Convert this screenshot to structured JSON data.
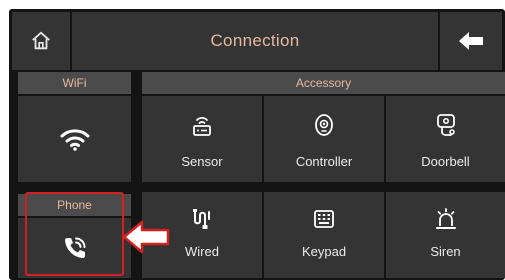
{
  "header": {
    "title": "Connection",
    "home_icon": "home-icon",
    "back_icon": "arrow-left-icon"
  },
  "left": {
    "wifi": {
      "label": "WiFi",
      "icon": "wifi-icon"
    },
    "phone": {
      "label": "Phone",
      "icon": "phone-signal-icon"
    }
  },
  "accessory": {
    "label": "Accessory",
    "items": [
      {
        "label": "Sensor",
        "icon": "sensor-icon"
      },
      {
        "label": "Controller",
        "icon": "controller-icon"
      },
      {
        "label": "Doorbell",
        "icon": "doorbell-icon"
      },
      {
        "label": "Wired",
        "icon": "wired-icon"
      },
      {
        "label": "Keypad",
        "icon": "keypad-icon"
      },
      {
        "label": "Siren",
        "icon": "siren-icon"
      }
    ]
  },
  "colors": {
    "accent_text": "#e7b99e",
    "panel": "#343434",
    "background": "#141414",
    "annotation": "#d32020"
  }
}
